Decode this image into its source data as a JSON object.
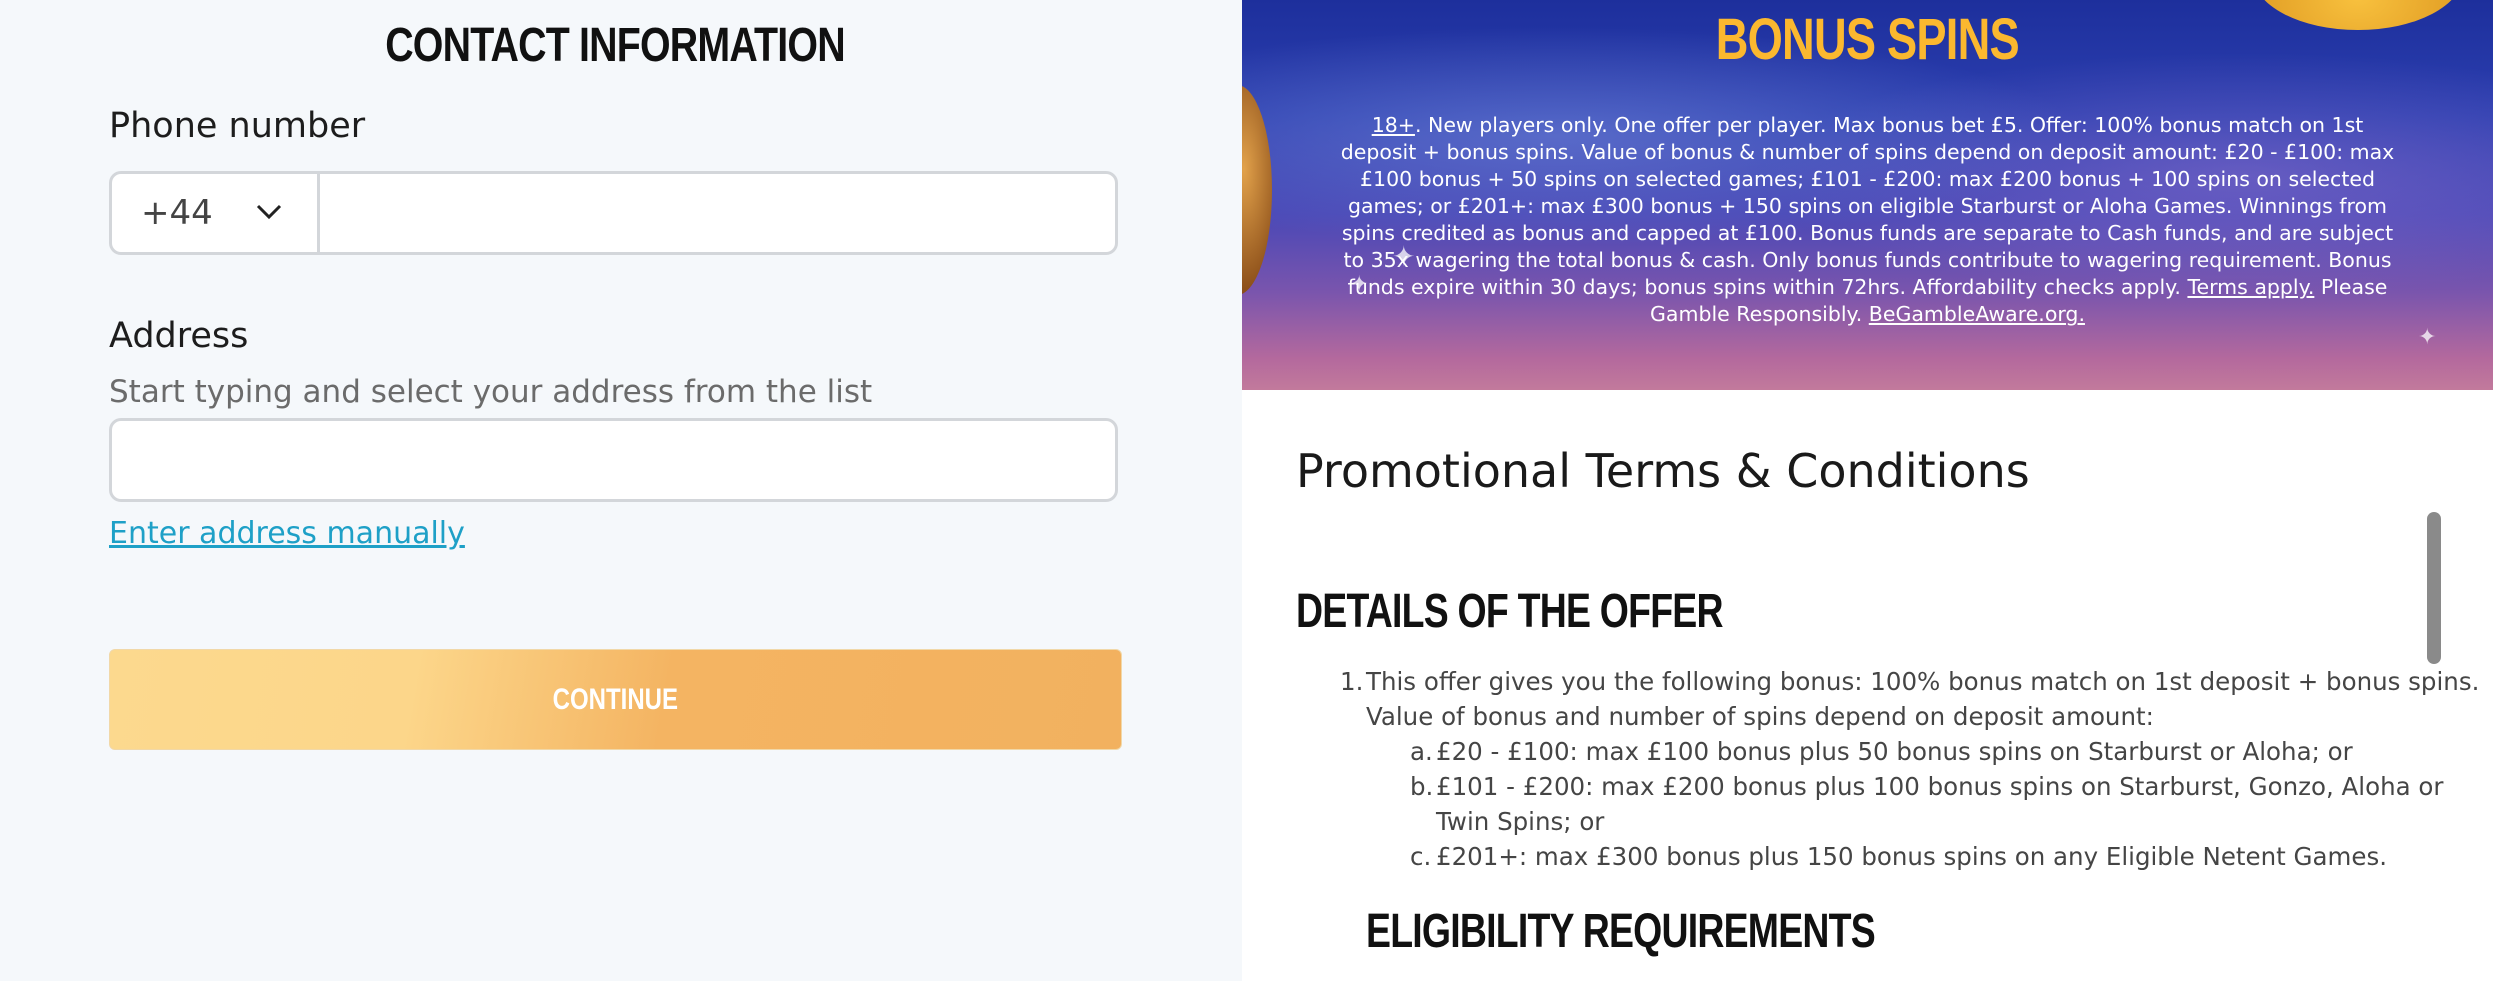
{
  "contact": {
    "title": "CONTACT INFORMATION",
    "phone_label": "Phone number",
    "country_code": "+44",
    "phone_value": "",
    "address_label": "Address",
    "address_help": "Start typing and select your address from the list",
    "address_value": "",
    "manual_link": "Enter address manually",
    "continue_label": "CONTINUE"
  },
  "banner": {
    "title": "BONUS SPINS",
    "terms_18": "18+",
    "terms_body": ". New players only. One offer per player. Max bonus bet £5. Offer: 100% bonus match on 1st deposit + bonus spins. Value of bonus & number of spins depend on deposit amount: £20 - £100: max £100 bonus + 50 spins on selected games; £101 - £200: max £200 bonus + 100 spins on selected games; or £201+: max £300 bonus + 150 spins on eligible Starburst or Aloha Games. Winnings from spins credited as bonus and capped at £100. Bonus funds are separate to Cash funds, and are subject to 35x wagering the total bonus & cash. Only bonus funds contribute to wagering requirement. Bonus funds expire within 30 days; bonus spins within 72hrs. Affordability checks apply.",
    "terms_apply": "Terms apply.",
    "gamble_text": " Please Gamble Responsibly. ",
    "gambleaware": "BeGambleAware.org."
  },
  "promo": {
    "title": "Promotional Terms & Conditions",
    "section1": "DETAILS OF THE OFFER",
    "item1_num": "1.",
    "item1": "This offer gives you the following bonus: 100% bonus match on 1st deposit + bonus spins. Value of bonus and number of spins depend on deposit amount:",
    "sub": [
      {
        "marker": "a.",
        "text": "£20 - £100: max £100 bonus plus 50 bonus spins on Starburst or Aloha; or"
      },
      {
        "marker": "b.",
        "text": "£101 - £200: max £200 bonus plus 100 bonus spins on Starburst, Gonzo, Aloha or Twin Spins; or"
      },
      {
        "marker": "c.",
        "text": "£201+: max £300 bonus plus 150 bonus spins on any Eligible Netent Games."
      }
    ],
    "section2": "ELIGIBILITY REQUIREMENTS"
  },
  "colors": {
    "accent_link": "#1ea0c7",
    "banner_title": "#fbb82f",
    "button_gradient_start": "#fcd98e",
    "button_gradient_end": "#f2b15f"
  },
  "icons": {
    "country_dropdown": "chevron-down-icon"
  }
}
